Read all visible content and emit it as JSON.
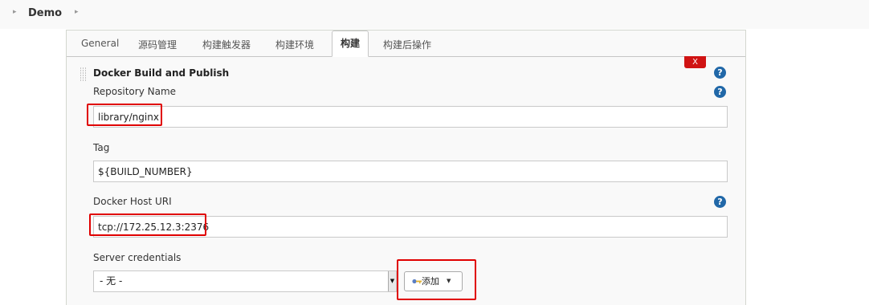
{
  "breadcrumb": {
    "item": "Demo"
  },
  "tabs": [
    {
      "label": "General"
    },
    {
      "label": "源码管理"
    },
    {
      "label": "构建触发器"
    },
    {
      "label": "构建环境"
    },
    {
      "label": "构建"
    },
    {
      "label": "构建后操作"
    }
  ],
  "active_tab": "构建",
  "section": {
    "title": "Docker Build and Publish",
    "delete_label": "X",
    "help_glyph": "?"
  },
  "fields": {
    "repository_name": {
      "label": "Repository Name",
      "value": "library/nginx"
    },
    "tag": {
      "label": "Tag",
      "value": "${BUILD_NUMBER}"
    },
    "docker_host_uri": {
      "label": "Docker Host URI",
      "value": "tcp://172.25.12.3:2376"
    },
    "server_credentials": {
      "label": "Server credentials",
      "selected": "- 无 -",
      "add_label": "添加"
    }
  },
  "colors": {
    "help_icon": "#2168a8",
    "delete_button": "#d01313",
    "highlight": "#e00000"
  }
}
